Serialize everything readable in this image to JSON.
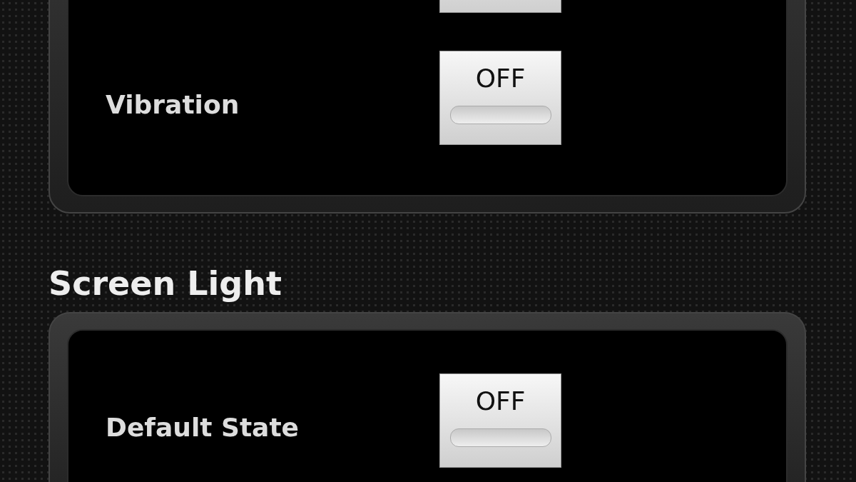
{
  "sections": [
    {
      "rows": [
        {
          "kind": "cut"
        },
        {
          "kind": "toggle",
          "label": "Vibration",
          "state": "OFF",
          "on": false
        }
      ]
    },
    {
      "title": "Screen Light",
      "rows": [
        {
          "kind": "toggle",
          "label": "Default State",
          "state": "OFF",
          "on": false
        }
      ]
    }
  ]
}
